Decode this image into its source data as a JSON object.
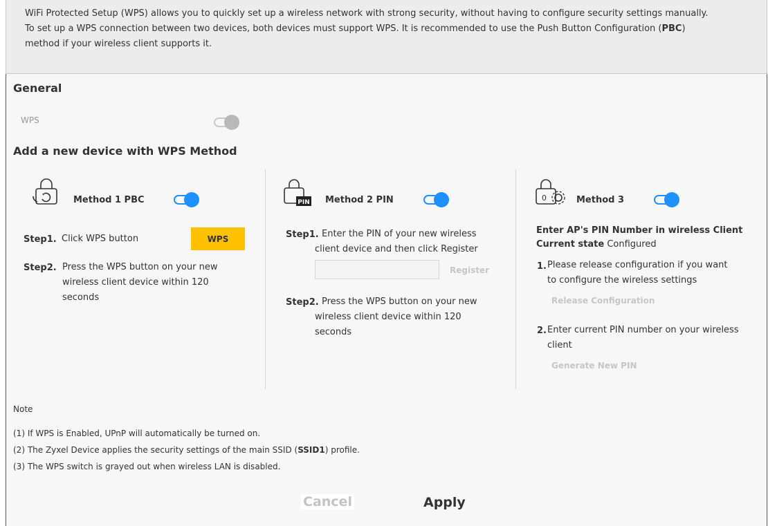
{
  "intro": {
    "line1": "WiFi Protected Setup (WPS) allows you to quickly set up a wireless network with strong security, without having to configure security settings manually.",
    "line2_pre": "To set up a WPS connection between two devices, both devices must support WPS. It is recommended to use the Push Button Configuration (",
    "line2_bold": "PBC",
    "line2_post": ")",
    "line3": "method if your wireless client supports it."
  },
  "general": {
    "title": "General",
    "wps_label": "WPS",
    "wps_enabled": false
  },
  "add_device": {
    "title": "Add a new device with WPS Method"
  },
  "method1": {
    "title": "Method 1 PBC",
    "icon": "lock-refresh-icon",
    "enabled": true,
    "step1_label": "Step1.",
    "step1_text": "Click WPS button",
    "wps_button": "WPS",
    "step2_label": "Step2.",
    "step2_lines": [
      "Press the WPS button on your new",
      "wireless client device within 120",
      "seconds"
    ]
  },
  "method2": {
    "title": "Method 2 PIN",
    "icon": "lock-pin-icon",
    "enabled": true,
    "step1_label": "Step1.",
    "step1_lines": [
      "Enter the PIN of your new wireless",
      "client device and then click Register"
    ],
    "pin_value": "",
    "register_button": "Register",
    "step2_label": "Step2.",
    "step2_lines": [
      "Press the WPS button on your new",
      "wireless client device within 120",
      "seconds"
    ]
  },
  "method3": {
    "title": "Method 3",
    "icon": "lock-gear-icon",
    "enabled": true,
    "heading": "Enter AP's PIN Number in wireless Client",
    "state_label": "Current state",
    "state_value": "Configured",
    "item1_num": "1.",
    "item1_lines": [
      "Please release configuration if you want",
      "to configure the wireless settings"
    ],
    "release_button": "Release Configuration",
    "item2_num": "2.",
    "item2_lines": [
      "Enter current PIN number on your wireless",
      "client"
    ],
    "generate_button": "Generate New PIN"
  },
  "notes": {
    "title": "Note",
    "n1": "(1) If WPS is Enabled, UPnP will automatically be turned on.",
    "n2_pre": "(2) The Zyxel Device applies the security settings of the main SSID (",
    "n2_bold": "SSID1",
    "n2_post": ") profile.",
    "n3": "(3) The WPS switch is grayed out when wireless LAN is disabled."
  },
  "footer": {
    "cancel": "Cancel",
    "apply": "Apply"
  },
  "colors": {
    "accent": "#1e90ff",
    "button_yellow": "#ffc000"
  }
}
